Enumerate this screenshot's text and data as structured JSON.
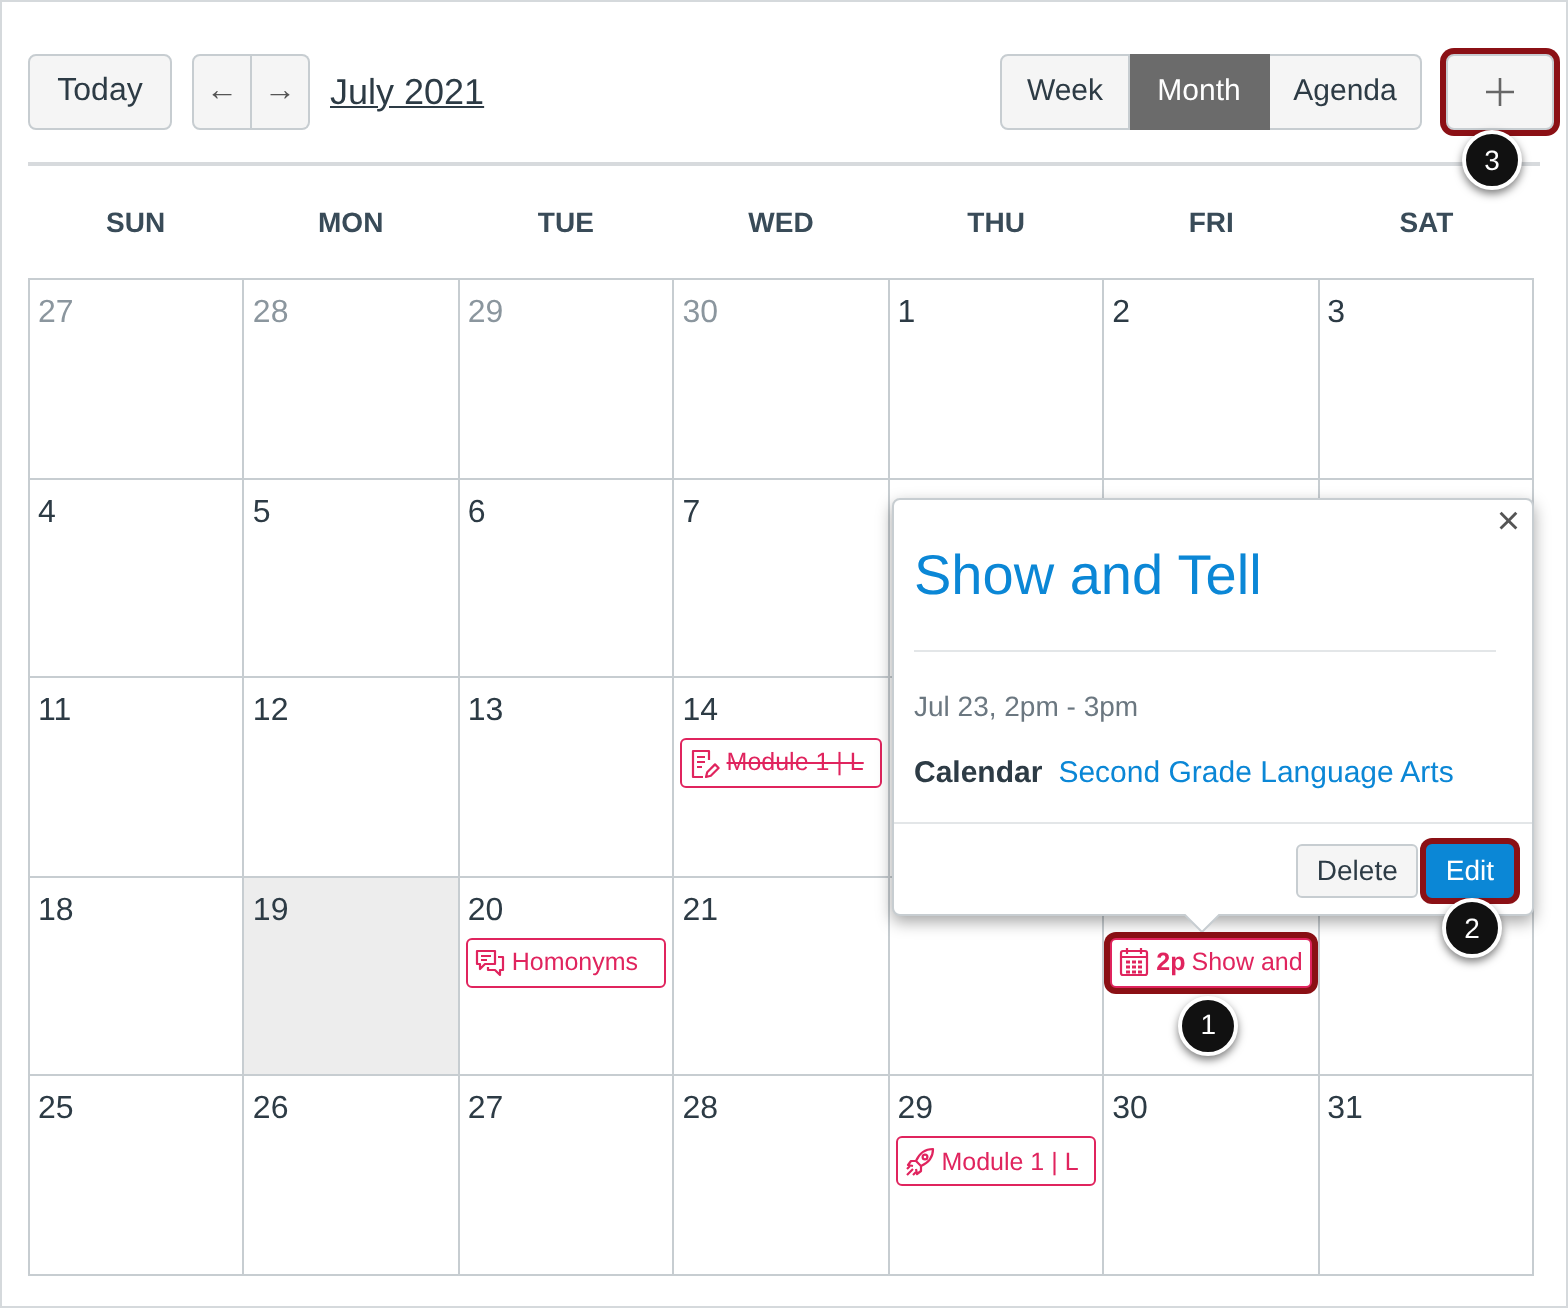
{
  "toolbar": {
    "today_button": "Today",
    "prev_button": "←",
    "next_button": "→",
    "title": "July 2021",
    "views": [
      {
        "label": "Week",
        "selected": false
      },
      {
        "label": "Month",
        "selected": true
      },
      {
        "label": "Agenda",
        "selected": false
      }
    ],
    "add_button": {
      "callout": "3"
    }
  },
  "weekdays": [
    "SUN",
    "MON",
    "TUE",
    "WED",
    "THU",
    "FRI",
    "SAT"
  ],
  "weeks": [
    [
      {
        "day": "27",
        "outside_month": true,
        "today": false
      },
      {
        "day": "28",
        "outside_month": true,
        "today": false
      },
      {
        "day": "29",
        "outside_month": true,
        "today": false
      },
      {
        "day": "30",
        "outside_month": true,
        "today": false
      },
      {
        "day": "1",
        "outside_month": false,
        "today": false
      },
      {
        "day": "2",
        "outside_month": false,
        "today": false
      },
      {
        "day": "3",
        "outside_month": false,
        "today": false
      }
    ],
    [
      {
        "day": "4",
        "outside_month": false,
        "today": false
      },
      {
        "day": "5",
        "outside_month": false,
        "today": false
      },
      {
        "day": "6",
        "outside_month": false,
        "today": false
      },
      {
        "day": "7",
        "outside_month": false,
        "today": false
      },
      {
        "today": false
      },
      {
        "today": false
      },
      {
        "today": false
      }
    ],
    [
      {
        "day": "11",
        "outside_month": false,
        "today": false
      },
      {
        "day": "12",
        "outside_month": false,
        "today": false
      },
      {
        "day": "13",
        "outside_month": false,
        "today": false
      },
      {
        "day": "14",
        "outside_month": false,
        "today": false,
        "events": [
          {
            "kind": "assignment",
            "title": "Module 1 | L",
            "completed": true
          }
        ]
      },
      {
        "today": false
      }
    ],
    [
      {
        "day": "18",
        "outside_month": false,
        "today": false
      },
      {
        "day": "19",
        "outside_month": false,
        "today": true
      },
      {
        "day": "20",
        "outside_month": false,
        "today": false,
        "events": [
          {
            "kind": "discussion",
            "title": "Homonyms",
            "completed": false
          }
        ]
      },
      {
        "day": "21",
        "outside_month": false,
        "today": false
      },
      {
        "today": false
      },
      {
        "today": false,
        "events": [
          {
            "kind": "event",
            "time": "2p",
            "title": "Show and",
            "completed": false,
            "callout": "1"
          }
        ]
      },
      {
        "today": false
      }
    ],
    [
      {
        "day": "25",
        "outside_month": false,
        "today": false
      },
      {
        "day": "26",
        "outside_month": false,
        "today": false
      },
      {
        "day": "27",
        "outside_month": false,
        "today": false
      },
      {
        "day": "28",
        "outside_month": false,
        "today": false
      },
      {
        "day": "29",
        "outside_month": false,
        "today": false,
        "events": [
          {
            "kind": "quiz",
            "title": "Module 1 | L",
            "completed": false
          }
        ]
      },
      {
        "day": "30",
        "outside_month": false,
        "today": false
      },
      {
        "day": "31",
        "outside_month": false,
        "today": false
      }
    ]
  ],
  "popover": {
    "close": "×",
    "title": "Show and Tell",
    "when": "Jul 23, 2pm - 3pm",
    "calendar_label": "Calendar",
    "calendar_name": "Second Grade Language Arts",
    "buttons": [
      {
        "label": "Delete",
        "kind": "secondary"
      },
      {
        "label": "Edit",
        "kind": "primary",
        "callout": "2"
      }
    ]
  }
}
